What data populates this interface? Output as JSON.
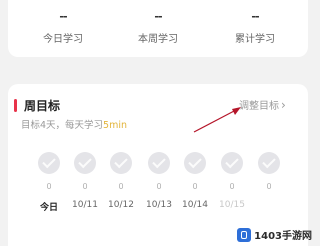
{
  "stats": [
    {
      "value": "--",
      "label": "今日学习"
    },
    {
      "value": "--",
      "label": "本周学习"
    },
    {
      "value": "--",
      "label": "累计学习"
    }
  ],
  "goal": {
    "title": "周目标",
    "adjust_label": "调整目标",
    "desc_prefix": "目标4天，每天学习",
    "desc_highlight": "5min",
    "accent_color": "#e8334a",
    "highlight_color": "#e3b53c"
  },
  "days": [
    {
      "count": "0",
      "label": "今日",
      "state": "today"
    },
    {
      "count": "0",
      "label": "10/11",
      "state": "past"
    },
    {
      "count": "0",
      "label": "10/12",
      "state": "past"
    },
    {
      "count": "0",
      "label": "10/13",
      "state": "past"
    },
    {
      "count": "0",
      "label": "10/14",
      "state": "past"
    },
    {
      "count": "0",
      "label": "10/15",
      "state": "future"
    },
    {
      "count": "0",
      "label": "",
      "state": "future"
    }
  ],
  "watermark": {
    "text": "1403手游网"
  }
}
